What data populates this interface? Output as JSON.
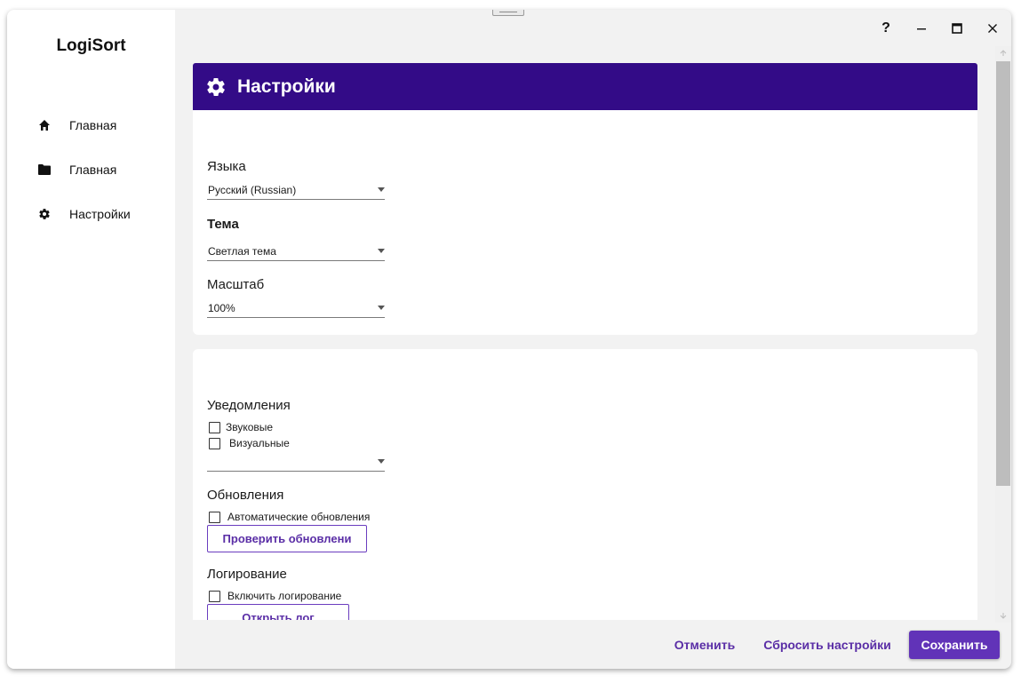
{
  "app": {
    "title": "LogiSort"
  },
  "sidebar": {
    "items": [
      {
        "label": "Главная",
        "icon": "home-icon"
      },
      {
        "label": "Главная",
        "icon": "folder-icon"
      },
      {
        "label": "Настройки",
        "icon": "gear-icon"
      }
    ]
  },
  "window_controls": {
    "help": "?",
    "minimize": "–",
    "maximize": "□",
    "close": "✕"
  },
  "header": {
    "title": "Настройки",
    "icon": "gear-icon",
    "color": "#330b87"
  },
  "general": {
    "language_label": "Языка",
    "language_value": "Русский (Russian)",
    "theme_label": "Тема",
    "theme_value": "Светлая тема",
    "scale_label": "Масштаб",
    "scale_value": "100%"
  },
  "notifications": {
    "label": "Уведомления",
    "sound_label": "Звуковые",
    "visual_label": "Визуальные",
    "combo_value": ""
  },
  "updates": {
    "label": "Обновления",
    "auto_label": "Автоматические обновления",
    "check_button": "Проверить обновлени"
  },
  "logging": {
    "label": "Логирование",
    "enable_label": "Включить логирование",
    "open_log_button": "Открыть лог"
  },
  "footer": {
    "cancel": "Отменить",
    "reset": "Сбросить настройки",
    "save": "Сохранить"
  },
  "colors": {
    "accent": "#6133b8",
    "header": "#330b87",
    "background": "#f2f2f2"
  }
}
